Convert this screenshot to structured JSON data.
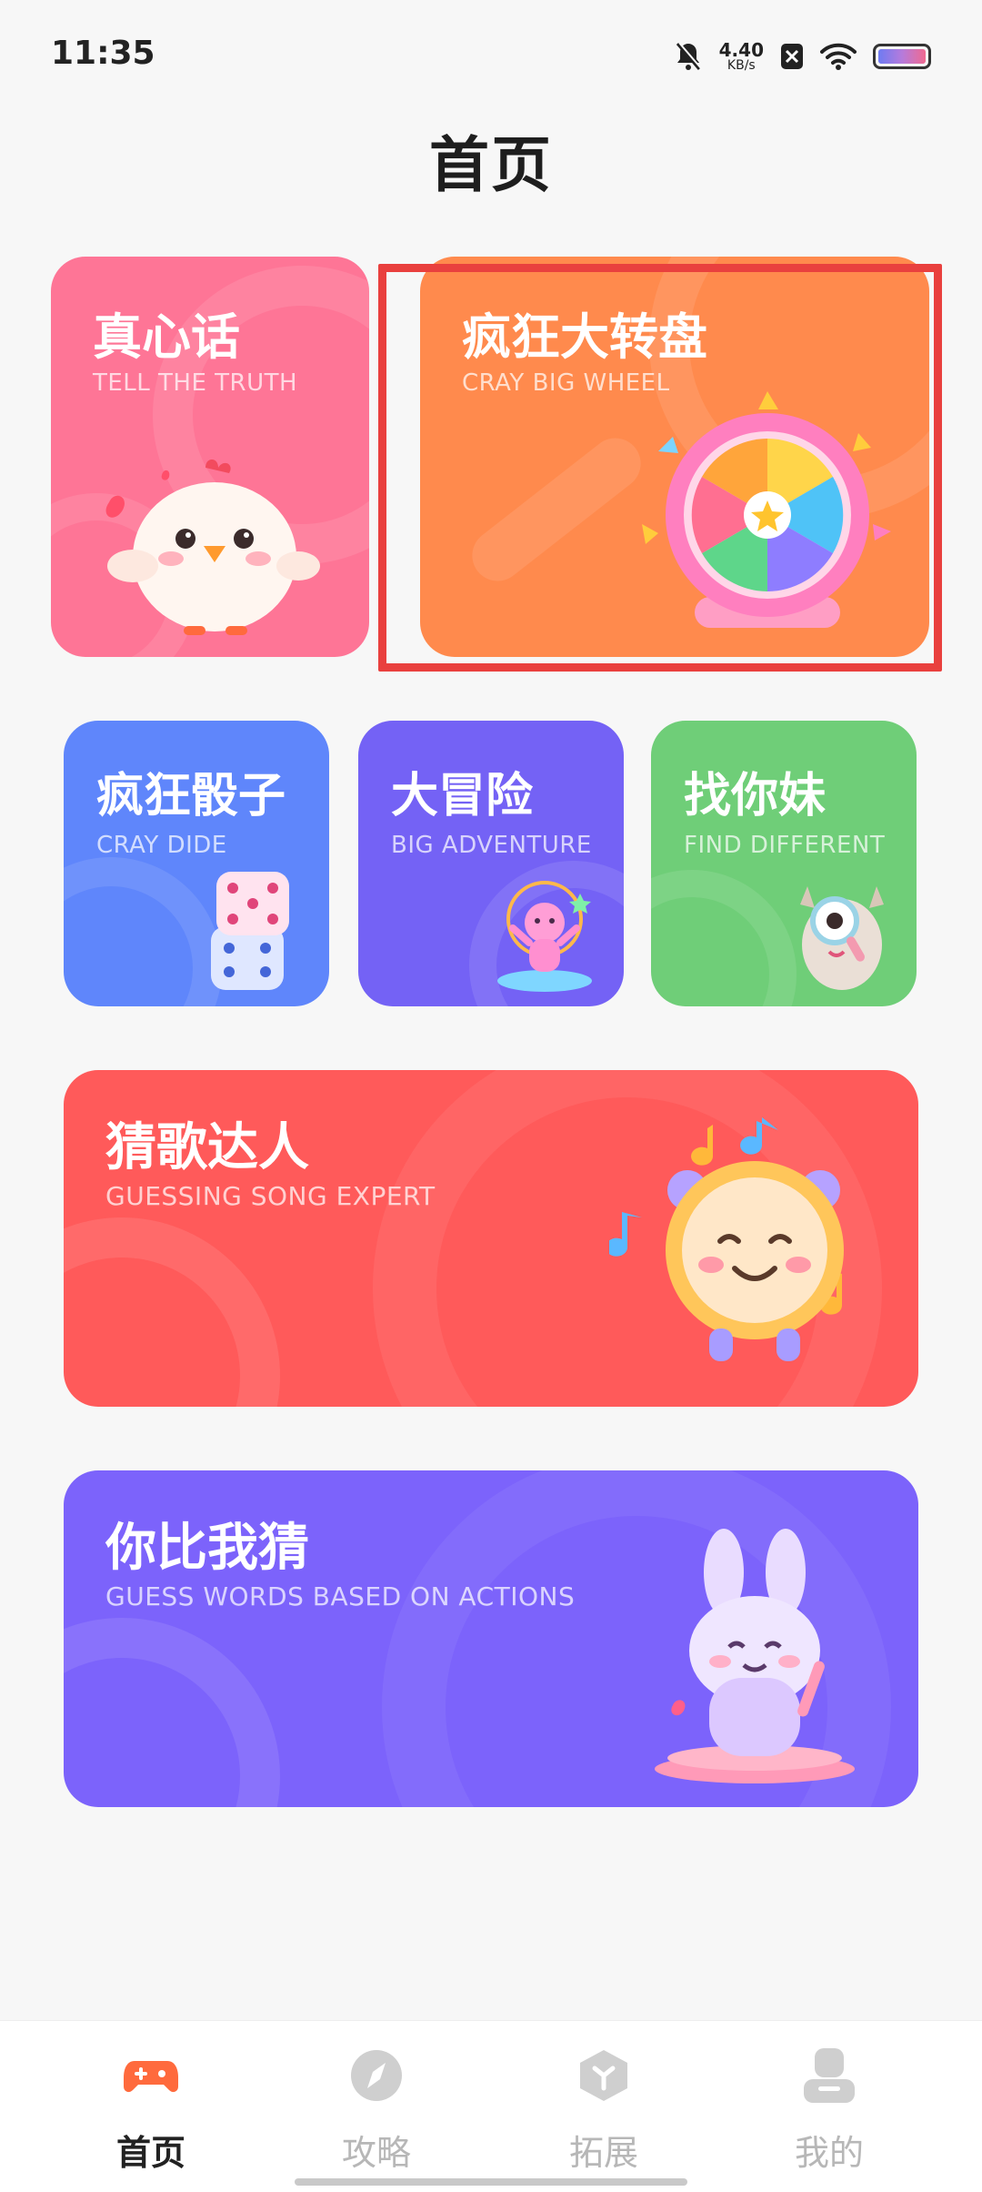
{
  "status_bar": {
    "time": "11:35",
    "net_speed_value": "4.40",
    "net_speed_unit": "KB/s"
  },
  "page": {
    "title": "首页"
  },
  "cards": {
    "truth": {
      "title": "真心话",
      "subtitle": "TELL THE TRUTH",
      "color": "#fe7596"
    },
    "wheel": {
      "title": "疯狂大转盘",
      "subtitle": "CRAY BIG WHEEL",
      "color": "#ff8a4d"
    },
    "dice": {
      "title": "疯狂骰子",
      "subtitle": "CRAY DIDE",
      "color": "#5f86fb"
    },
    "adventure": {
      "title": "大冒险",
      "subtitle": "BIG ADVENTURE",
      "color": "#7462f5"
    },
    "find": {
      "title": "找你妹",
      "subtitle": "FIND DIFFERENT",
      "color": "#6fce78"
    },
    "song": {
      "title": "猜歌达人",
      "subtitle": "GUESSING SONG EXPERT",
      "color": "#ff5a5a"
    },
    "words": {
      "title": "你比我猜",
      "subtitle": "GUESS WORDS BASED ON ACTIONS",
      "color": "#7c63fb"
    }
  },
  "bottom_nav": {
    "items": [
      {
        "label": "首页",
        "icon": "gamepad-icon",
        "active": true
      },
      {
        "label": "攻略",
        "icon": "compass-icon",
        "active": false
      },
      {
        "label": "拓展",
        "icon": "box-icon",
        "active": false
      },
      {
        "label": "我的",
        "icon": "user-icon",
        "active": false
      }
    ]
  },
  "colors": {
    "accent": "#ff6a3d",
    "highlight": "#e9403e",
    "inactive": "#b7b7b7"
  }
}
